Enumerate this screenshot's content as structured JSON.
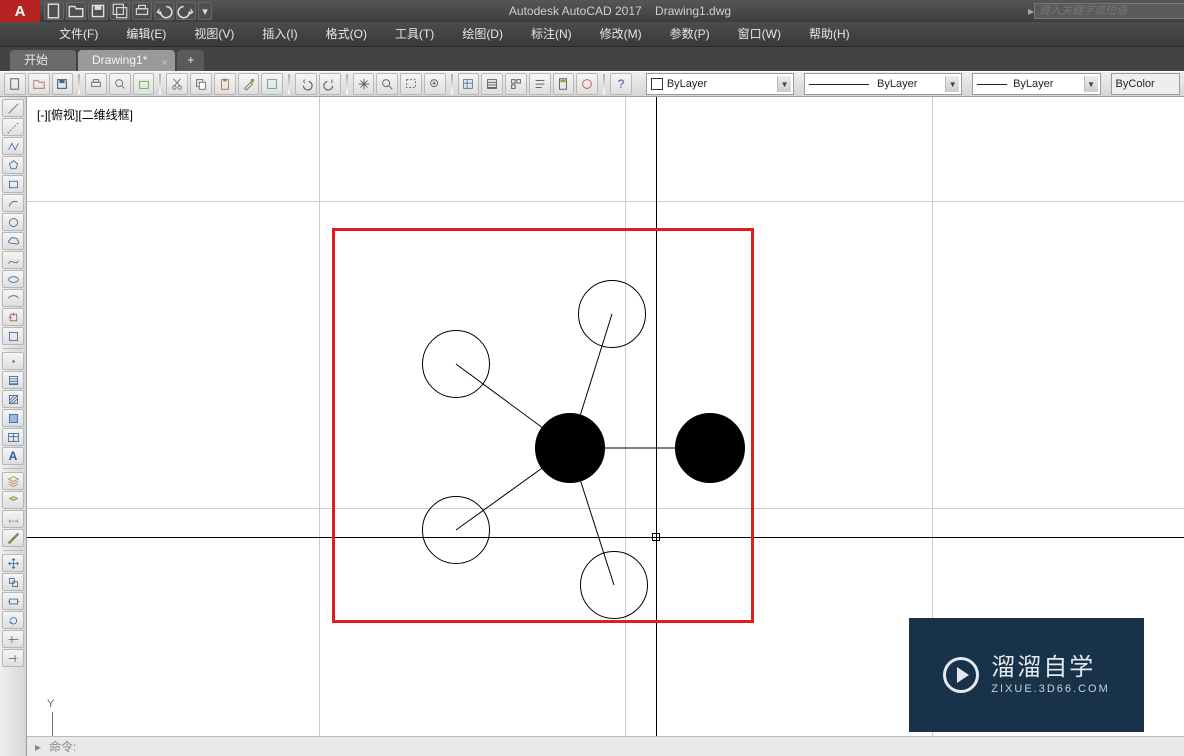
{
  "title": {
    "app": "Autodesk AutoCAD 2017",
    "doc": "Drawing1.dwg"
  },
  "search": {
    "placeholder": "键入关键字或短语"
  },
  "menu": {
    "file": "文件(F)",
    "edit": "编辑(E)",
    "view": "视图(V)",
    "insert": "插入(I)",
    "format": "格式(O)",
    "tools": "工具(T)",
    "draw": "绘图(D)",
    "dimension": "标注(N)",
    "modify": "修改(M)",
    "param": "参数(P)",
    "window": "窗口(W)",
    "help": "帮助(H)"
  },
  "tabs": {
    "start": "开始",
    "drawing": "Drawing1*"
  },
  "dropdowns": {
    "layer": "ByLayer",
    "linetype": "ByLayer",
    "lineweight": "ByLayer",
    "plotstyle": "ByColor"
  },
  "viewport": {
    "label": "[-][俯视][二维线框]"
  },
  "ucs": {
    "y": "Y"
  },
  "cmd": {
    "prompt": "命令:"
  },
  "watermark": {
    "title": "溜溜自学",
    "url": "ZIXUE.3D66.COM"
  }
}
